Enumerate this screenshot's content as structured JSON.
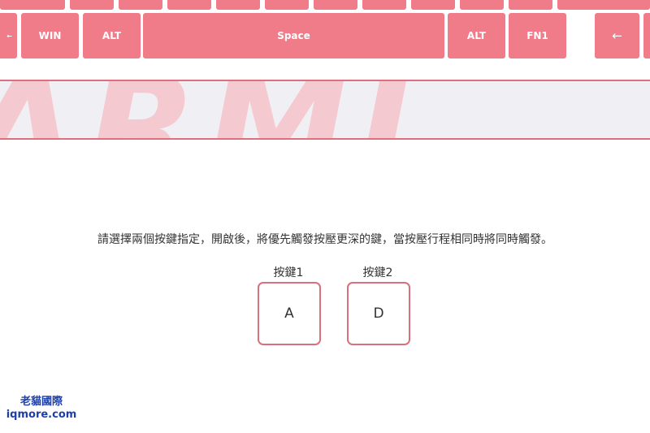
{
  "keyboard": {
    "bottom_row": [
      {
        "label": "←"
      },
      {
        "label": "WIN"
      },
      {
        "label": "ALT"
      },
      {
        "label": "Space"
      },
      {
        "label": "ALT"
      },
      {
        "label": "FN1"
      },
      {
        "label": "←"
      },
      {
        "label": ""
      }
    ],
    "key_color": "#f07c8a"
  },
  "banner": {
    "watermark_text": "ARMI",
    "border_color": "#df6f7d"
  },
  "instruction": "請選擇兩個按鍵指定，開啟後，將優先觸發按壓更深的鍵，當按壓行程相同時將同時觸發。",
  "slots": [
    {
      "label": "按鍵1",
      "value": "A"
    },
    {
      "label": "按鍵2",
      "value": "D"
    }
  ],
  "watermark": {
    "line1": "老貓國際",
    "line2": "iqmore.com"
  }
}
